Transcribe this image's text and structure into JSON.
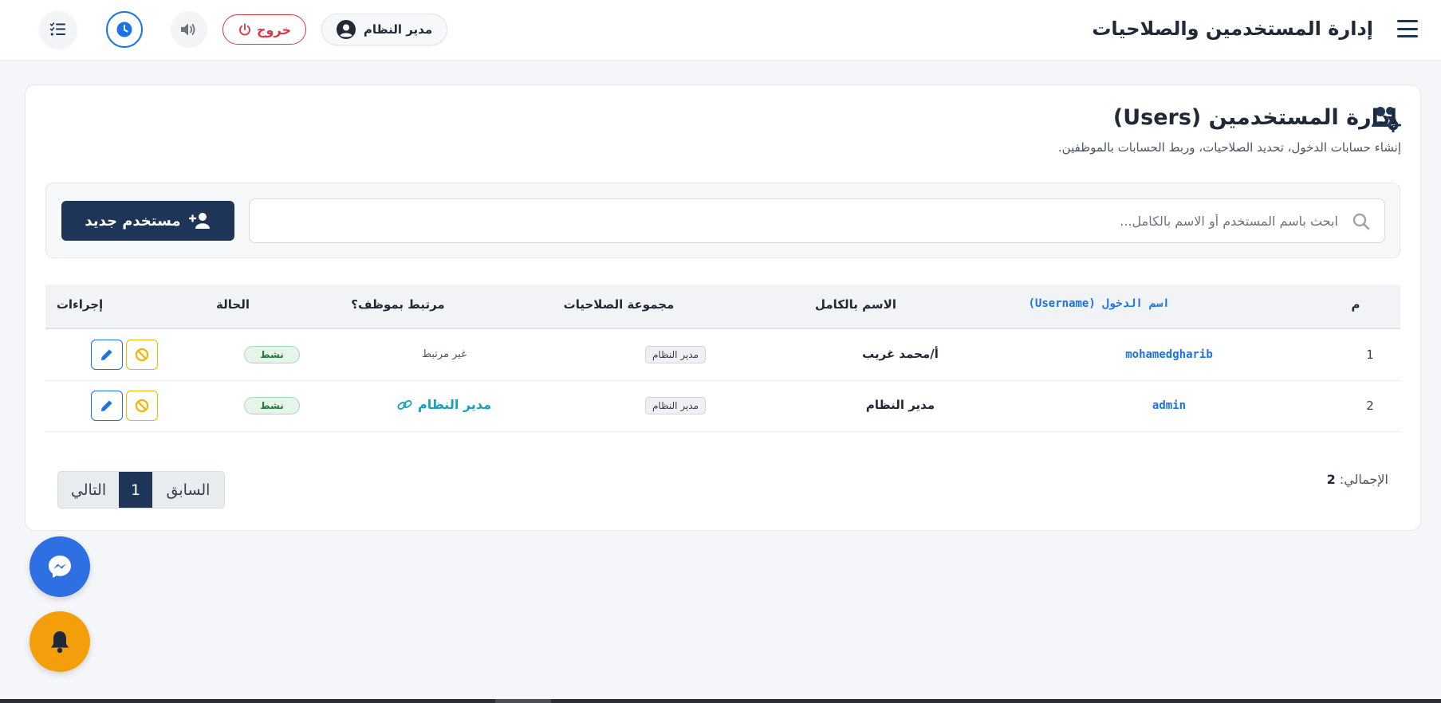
{
  "header": {
    "title": "إدارة المستخدمين والصلاحيات",
    "user_label": "مدير النظام",
    "logout_label": "خروج"
  },
  "section": {
    "title": "إدارة المستخدمين (Users)",
    "subtitle": "إنشاء حسابات الدخول، تحديد الصلاحيات، وربط الحسابات بالموظفين."
  },
  "search": {
    "placeholder": "ابحث باسم المستخدم أو الاسم بالكامل...",
    "value": ""
  },
  "new_user_label": "مستخدم جديد",
  "table": {
    "columns": {
      "index": "م",
      "username": "اسم الدخول (Username)",
      "fullname": "الاسم بالكامل",
      "group": "مجموعة الصلاحيات",
      "linked": "مرتبط بموظف؟",
      "status": "الحالة",
      "actions": "إجراءات"
    },
    "rows": [
      {
        "index": "1",
        "username": "mohamedgharib",
        "fullname": "أ/محمد غريب",
        "group": "مدير النظام",
        "linked": "غير مرتبط",
        "status": "نشط"
      },
      {
        "index": "2",
        "username": "admin",
        "fullname": "مدير النظام",
        "group": "مدير النظام",
        "linked": "مدير النظام",
        "status": "نشط"
      }
    ]
  },
  "footer": {
    "total_label": "الإجمالي:",
    "total_value": "2",
    "pagination": {
      "prev": "السابق",
      "current": "1",
      "next": "التالي"
    }
  },
  "colors": {
    "primary": "#1e3557",
    "link": "#1a73e8",
    "danger": "#dc3545",
    "success": "#1e7e34",
    "warning": "#f5b400",
    "teal": "#17a2b8",
    "messenger": "#2f6fe4",
    "bell": "#f59e0b"
  },
  "icons": {
    "menu": "hamburger-icon",
    "user": "user-circle-icon",
    "logout": "power-icon",
    "speaker": "speaker-icon",
    "clock": "clock-icon",
    "tasks": "tasks-icon",
    "section": "users-cog-icon",
    "search": "search-icon",
    "new_user": "user-plus-icon",
    "ban": "ban-icon",
    "edit": "pencil-icon",
    "link": "link-icon",
    "messenger": "messenger-icon",
    "bell": "bell-icon"
  }
}
